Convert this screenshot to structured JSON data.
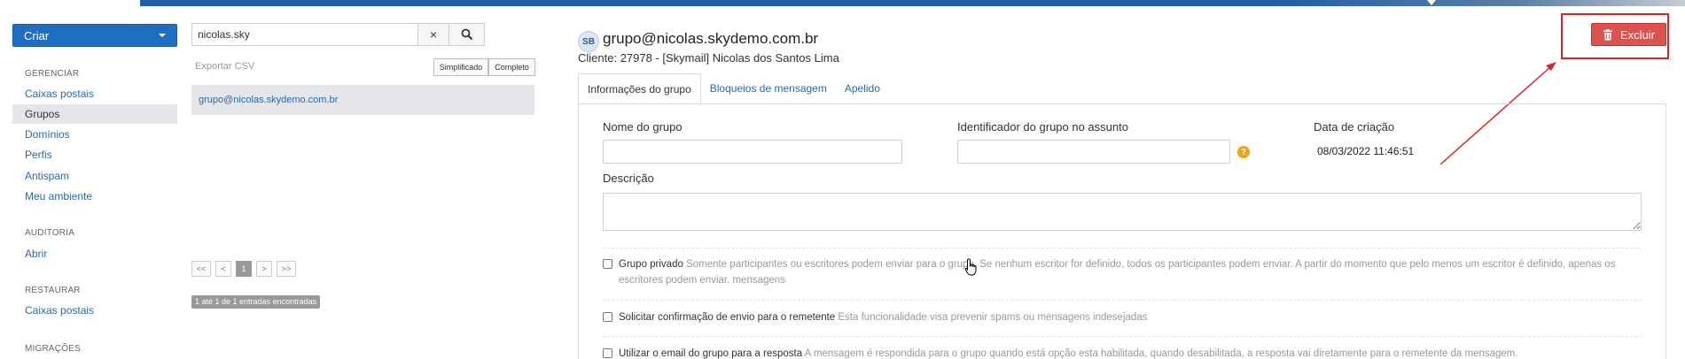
{
  "sidebar": {
    "create_button": "Criar",
    "sections": [
      {
        "title": "GERENCIAR",
        "items": [
          "Caixas postais",
          "Grupos",
          "Domínios",
          "Perfis",
          "Antispam",
          "Meu ambiente"
        ]
      },
      {
        "title": "AUDITORIA",
        "items": [
          "Abrir"
        ]
      },
      {
        "title": "RESTAURAR",
        "items": [
          "Caixas postais"
        ]
      },
      {
        "title": "MIGRAÇÕES",
        "items": []
      }
    ]
  },
  "search": {
    "value": "nicolas.sky",
    "clear_icon": "×",
    "search_icon": "search-icon"
  },
  "results": {
    "export_csv": "Exportar CSV",
    "view_simple": "Simplificado",
    "view_complete": "Completo",
    "items": [
      "grupo@nicolas.skydemo.com.br"
    ],
    "pagination": [
      "<<",
      "<",
      "1",
      ">",
      ">>"
    ],
    "count_text": "1 até 1 de 1 entradas encontradas"
  },
  "group": {
    "avatar_initials": "SB",
    "title": "grupo@nicolas.skydemo.com.br",
    "client": "Cliente: 27978 - [Skymail] Nicolas dos Santos Lima",
    "delete_label": "Excluir",
    "tabs": [
      "Informações do grupo",
      "Bloqueios de mensagem",
      "Apelido"
    ],
    "fields": {
      "name_label": "Nome do grupo",
      "name_value": "",
      "subject_id_label": "Identificador do grupo no assunto",
      "subject_id_value": "",
      "help_glyph": "?",
      "created_label": "Data de criação",
      "created_value": "08/03/2022 11:46:51",
      "description_label": "Descrição",
      "description_value": ""
    },
    "options": [
      {
        "label": "Grupo privado",
        "description": "Somente participantes ou escritores podem enviar para o grupo. Se nenhum escritor for definido, todos os participantes podem enviar. A partir do momento que pelo menos um escritor é definido, apenas os escritores podem enviar. mensagens",
        "checked": false
      },
      {
        "label": "Solicitar confirmação de envio para o remetente",
        "description": "Esta funcionalidade visa prevenir spams ou mensagens indesejadas",
        "checked": false
      },
      {
        "label": "Utilizar o email do grupo para a resposta",
        "description": "A mensagem é respondida para o grupo quando está opção esta habilitada, quando desabilitada, a resposta vai diretamente para o remetente da mensagem.",
        "checked": false
      }
    ]
  },
  "colors": {
    "primary": "#1e6fc1",
    "danger": "#d9534f",
    "annotation": "#d9242a",
    "link": "#2a6aaa"
  }
}
